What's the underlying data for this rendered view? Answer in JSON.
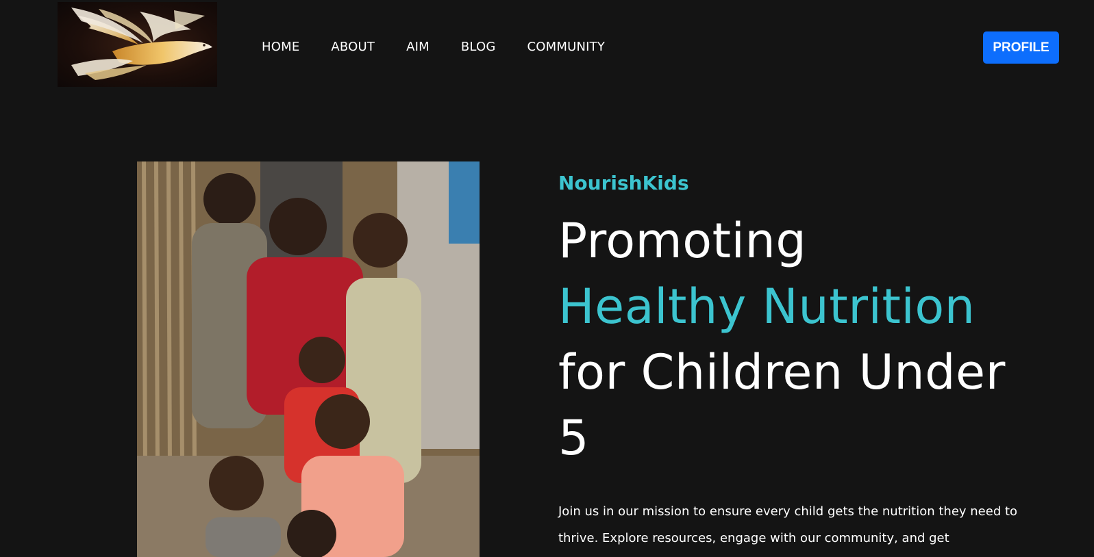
{
  "header": {
    "logo_alt": "Dove logo",
    "nav": [
      {
        "label": "HOME"
      },
      {
        "label": "ABOUT"
      },
      {
        "label": "AIM"
      },
      {
        "label": "BLOG"
      },
      {
        "label": "COMMUNITY"
      }
    ],
    "profile_label": "PROFILE"
  },
  "hero": {
    "brand": "NourishKids",
    "headline_line1": "Promoting",
    "headline_accent": "Healthy Nutrition",
    "headline_line3": "for Children Under",
    "headline_line4": "5",
    "intro": "Join us in our mission to ensure every child gets the nutrition they need to thrive. Explore resources, engage with our community, and get"
  },
  "colors": {
    "background": "#141414",
    "accent": "#3cc4cf",
    "primary_button": "#0d6efd",
    "text": "#ffffff"
  }
}
